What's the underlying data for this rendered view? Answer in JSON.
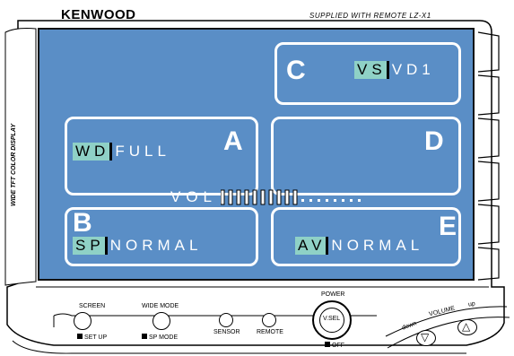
{
  "brand": "KENWOOD",
  "model_text": "SUPPLIED WITH REMOTE  LZ-X1",
  "side_label": "WIDE TFT COLOR DISPLAY",
  "screen": {
    "bg_color": "#5a8ec6",
    "highlight_color": "#8fd1c6",
    "section_a": {
      "letter": "A",
      "tag": "WD",
      "value": "FULL"
    },
    "section_b": {
      "letter": "B",
      "tag": "SP",
      "value": "NORMAL"
    },
    "section_c": {
      "letter": "C",
      "tag": "VS",
      "value": "VD1"
    },
    "section_d": {
      "letter": "D"
    },
    "section_e": {
      "letter": "E",
      "tag": "AV",
      "value": "NORMAL"
    },
    "volume_label": "VOL",
    "volume_level": 0.56
  },
  "controls": {
    "screen_label": "SCREEN",
    "screen_sub": "SET UP",
    "wide_mode_label": "WIDE MODE",
    "wide_mode_sub": "SP MODE",
    "sensor_label": "SENSOR",
    "remote_label": "REMOTE",
    "power_label": "POWER",
    "vsel_label": "V.SEL",
    "off_label": "OFF",
    "volume_label": "VOLUME",
    "down_label": "down",
    "up_label": "up"
  }
}
